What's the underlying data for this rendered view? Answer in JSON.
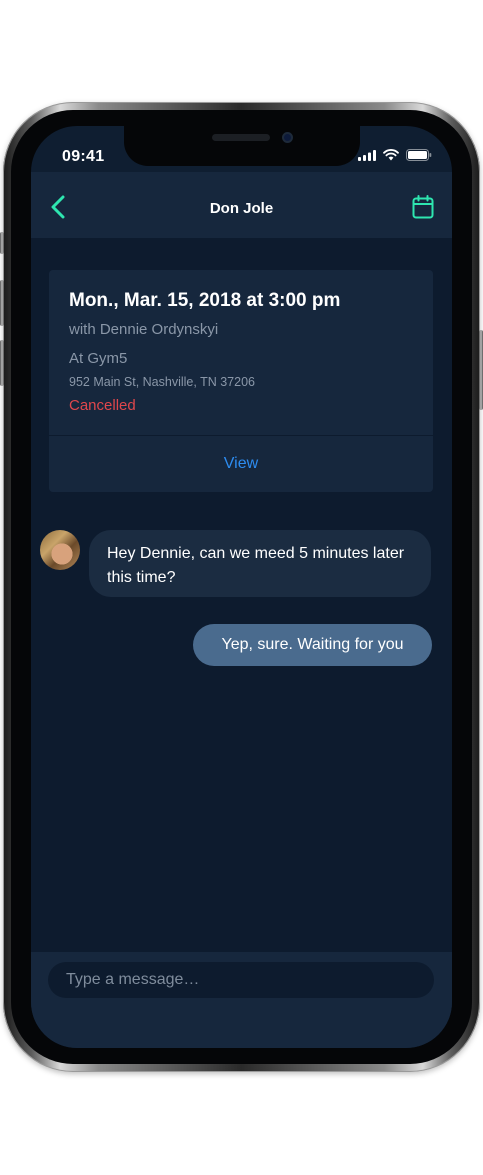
{
  "status_bar": {
    "time": "09:41"
  },
  "nav": {
    "title": "Don Jole",
    "back_icon": "chevron-left-icon",
    "calendar_icon": "calendar-icon"
  },
  "appointment": {
    "date": "Mon., Mar. 15, 2018 at 3:00 pm",
    "with": "with Dennie Ordynskyi",
    "location": "At Gym5",
    "address": "952 Main St, Nashville, TN 37206",
    "status": "Cancelled",
    "view_label": "View"
  },
  "messages": [
    {
      "direction": "incoming",
      "text": "Hey Dennie, can we meed 5 minutes later this time?"
    },
    {
      "direction": "outgoing",
      "text": "Yep, sure. Waiting for you"
    }
  ],
  "composer": {
    "placeholder": "Type a message…"
  },
  "colors": {
    "accent": "#2ee6b0",
    "link": "#2d8cf0",
    "cancelled": "#e0474c",
    "outgoing_bubble": "#4a6b8e"
  }
}
